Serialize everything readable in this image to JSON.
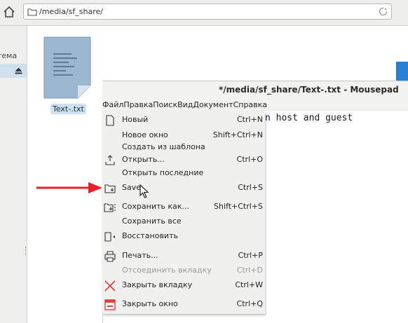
{
  "file_manager": {
    "path": "/media/sf_share/",
    "sidebar_label": "тема",
    "file_name": "Text-.txt"
  },
  "mousepad": {
    "title": "*/media/sf_share/Text-.txt - Mousepad",
    "menubar": [
      "Файл",
      "Правка",
      "Поиск",
      "Вид",
      "Документ",
      "Справка"
    ],
    "editor_text": "n host and guest"
  },
  "file_menu": {
    "items": [
      {
        "icon": "new-document-icon",
        "label": "Новый",
        "shortcut": "Ctrl+N"
      },
      {
        "icon": "",
        "label": "Новое окно",
        "shortcut": "Shift+Ctrl+N"
      },
      {
        "icon": "",
        "label": "Создать из шаблона",
        "shortcut": ""
      },
      {
        "icon": "open-icon",
        "label": "Открыть...",
        "shortcut": "Ctrl+O"
      },
      {
        "icon": "",
        "label": "Открыть последние",
        "shortcut": ""
      },
      {
        "icon": "save-icon",
        "label": "Save",
        "shortcut": "Ctrl+S"
      },
      {
        "icon": "save-as-icon",
        "label": "Сохранить как...",
        "shortcut": "Shift+Ctrl+S"
      },
      {
        "icon": "",
        "label": "Сохранить все",
        "shortcut": ""
      },
      {
        "icon": "revert-icon",
        "label": "Восстановить",
        "shortcut": ""
      },
      {
        "icon": "print-icon",
        "label": "Печать...",
        "shortcut": "Ctrl+P"
      },
      {
        "icon": "",
        "label": "Отсоединить вкладку",
        "shortcut": "Ctrl+D",
        "disabled": true
      },
      {
        "icon": "close-tab-icon",
        "label": "Закрыть вкладку",
        "shortcut": "Ctrl+W"
      },
      {
        "icon": "close-window-icon",
        "label": "Закрыть окно",
        "shortcut": "Ctrl+Q"
      }
    ]
  },
  "colors": {
    "arrow": "#e8202a",
    "selection": "#cfe0f1",
    "close_red": "#e03c3c"
  }
}
